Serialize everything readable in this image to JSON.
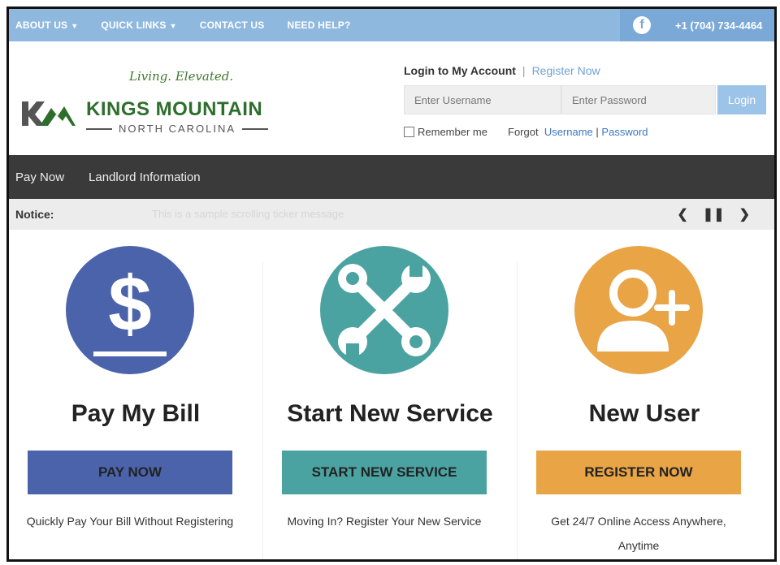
{
  "topbar": {
    "nav": [
      "ABOUT US",
      "QUICK LINKS",
      "CONTACT US",
      "NEED HELP?"
    ],
    "facebook_glyph": "f",
    "phone": "+1 (704) 734-4464",
    "color": "#8fb8df"
  },
  "header": {
    "tagline": "Living. Elevated.",
    "brand": "KINGS MOUNTAIN",
    "brand_sub": "NORTH CAROLINA"
  },
  "login": {
    "title": "Login to My Account",
    "separator": "|",
    "register": "Register Now",
    "username_placeholder": "Enter Username",
    "password_placeholder": "Enter Password",
    "button": "Login",
    "remember": "Remember me",
    "forgot": "Forgot",
    "username_link": "Username",
    "link_sep": "|",
    "password_link": "Password"
  },
  "mainnav": [
    "Pay Now",
    "Landlord Information"
  ],
  "notice": {
    "label": "Notice:",
    "text": "This is a sample scrolling ticker message"
  },
  "cards": [
    {
      "title": "Pay My Bill",
      "button": "PAY NOW",
      "desc": "Quickly Pay Your Bill Without Registering",
      "color": "#4a63aa",
      "icon": "dollar-icon"
    },
    {
      "title": "Start New Service",
      "button": "START NEW SERVICE",
      "desc": "Moving In? Register Your New Service",
      "color": "#4aa3a1",
      "icon": "tools-icon"
    },
    {
      "title": "New User",
      "button": "REGISTER NOW",
      "desc": "Get 24/7 Online Access Anywhere, Anytime",
      "color": "#e8a445",
      "icon": "add-user-icon"
    }
  ]
}
